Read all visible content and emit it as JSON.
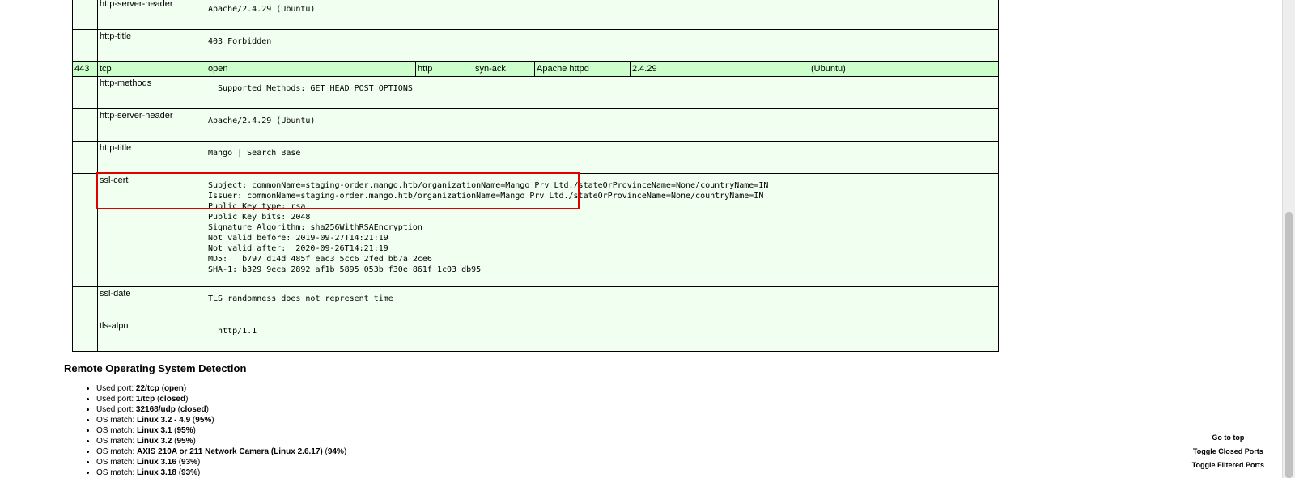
{
  "ports_table": {
    "top_rows": [
      {
        "name": "http-server-header",
        "output": "Apache/2.4.29 (Ubuntu)"
      },
      {
        "name": "http-title",
        "output": "403 Forbidden"
      }
    ],
    "port_row": {
      "port": "443",
      "protocol": "tcp",
      "state": "open",
      "service": "http",
      "reason": "syn-ack",
      "product": "Apache httpd",
      "version": "2.4.29",
      "extra": "(Ubuntu)"
    },
    "bottom_rows": [
      {
        "name": "http-methods",
        "output": "  Supported Methods: GET HEAD POST OPTIONS"
      },
      {
        "name": "http-server-header",
        "output": "Apache/2.4.29 (Ubuntu)"
      },
      {
        "name": "http-title",
        "output": "Mango | Search Base"
      },
      {
        "name": "ssl-cert",
        "output": "Subject: commonName=staging-order.mango.htb/organizationName=Mango Prv Ltd./stateOrProvinceName=None/countryName=IN\nIssuer: commonName=staging-order.mango.htb/organizationName=Mango Prv Ltd./stateOrProvinceName=None/countryName=IN\nPublic Key type: rsa\nPublic Key bits: 2048\nSignature Algorithm: sha256WithRSAEncryption\nNot valid before: 2019-09-27T14:21:19\nNot valid after:  2020-09-26T14:21:19\nMD5:   b797 d14d 485f eac3 5cc6 2fed bb7a 2ce6\nSHA-1: b329 9eca 2892 af1b 5895 053b f30e 861f 1c03 db95"
      },
      {
        "name": "ssl-date",
        "output": "TLS randomness does not represent time"
      },
      {
        "name": "tls-alpn",
        "output": "  http/1.1"
      }
    ]
  },
  "os_detection": {
    "heading": "Remote Operating System Detection",
    "items": [
      {
        "prefix": "Used port: ",
        "bold": "22/tcp",
        "open": " (",
        "bold2": "open",
        "close": ")"
      },
      {
        "prefix": "Used port: ",
        "bold": "1/tcp",
        "open": " (",
        "bold2": "closed",
        "close": ")"
      },
      {
        "prefix": "Used port: ",
        "bold": "32168/udp",
        "open": " (",
        "bold2": "closed",
        "close": ")"
      },
      {
        "prefix": "OS match: ",
        "bold": "Linux 3.2 - 4.9",
        "open": " (",
        "bold2": "95%",
        "close": ")"
      },
      {
        "prefix": "OS match: ",
        "bold": "Linux 3.1",
        "open": " (",
        "bold2": "95%",
        "close": ")"
      },
      {
        "prefix": "OS match: ",
        "bold": "Linux 3.2",
        "open": " (",
        "bold2": "95%",
        "close": ")"
      },
      {
        "prefix": "OS match: ",
        "bold": "AXIS 210A or 211 Network Camera (Linux 2.6.17)",
        "open": " (",
        "bold2": "94%",
        "close": ")"
      },
      {
        "prefix": "OS match: ",
        "bold": "Linux 3.16",
        "open": " (",
        "bold2": "93%",
        "close": ")"
      },
      {
        "prefix": "OS match: ",
        "bold": "Linux 3.18",
        "open": " (",
        "bold2": "93%",
        "close": ")"
      }
    ]
  },
  "side_links": {
    "go_to_top": "Go to top",
    "toggle_closed": "Toggle Closed Ports",
    "toggle_filtered": "Toggle Filtered Ports"
  },
  "colors": {
    "script_row_bg": "#f0fff0",
    "open_row_bg": "#ccffcc",
    "highlight_box": "#e00000"
  }
}
